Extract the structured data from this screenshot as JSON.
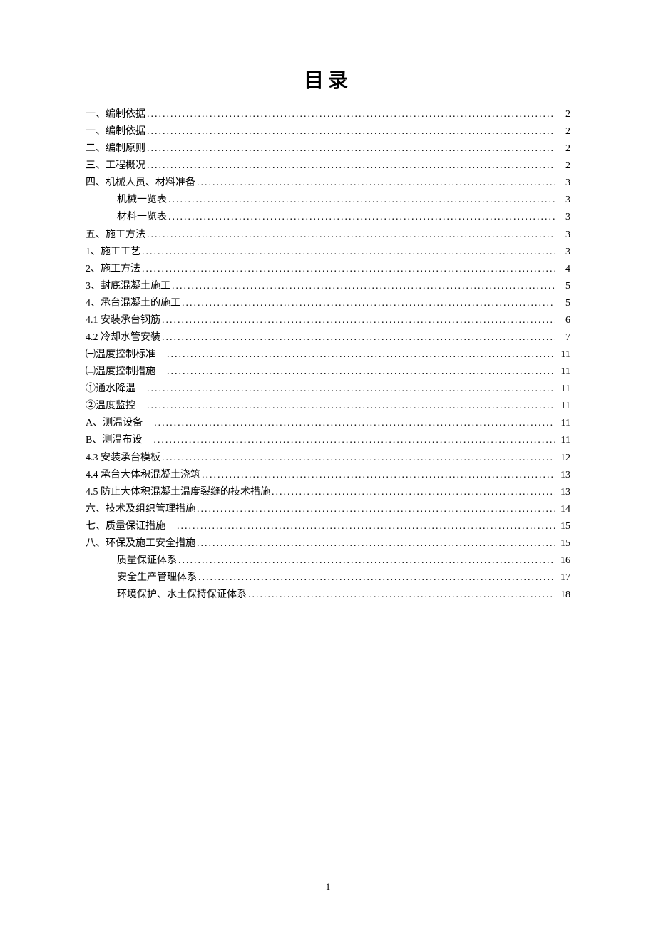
{
  "title": "目录",
  "page_number": "1",
  "toc": [
    {
      "label": "一、编制依据",
      "page": "2",
      "indent": false
    },
    {
      "label": "一、编制依据",
      "page": "2",
      "indent": false
    },
    {
      "label": "二、编制原则",
      "page": "2",
      "indent": false
    },
    {
      "label": "三、工程概况",
      "page": "2",
      "indent": false
    },
    {
      "label": "四、机械人员、材料准备",
      "page": "3",
      "indent": false
    },
    {
      "label": "机械一览表",
      "page": "3",
      "indent": true
    },
    {
      "label": "材料一览表",
      "page": "3",
      "indent": true
    },
    {
      "label": "五、施工方法",
      "page": "3",
      "indent": false
    },
    {
      "label": "1、施工工艺",
      "page": "3",
      "indent": false
    },
    {
      "label": "2、施工方法",
      "page": "4",
      "indent": false
    },
    {
      "label": "3、封底混凝土施工",
      "page": "5",
      "indent": false
    },
    {
      "label": "4、承台混凝土的施工",
      "page": "5",
      "indent": false
    },
    {
      "label": "4.1 安装承台钢筋",
      "page": "6",
      "indent": false
    },
    {
      "label": "4.2 冷却水管安装",
      "page": "7",
      "indent": false
    },
    {
      "label": "㈠温度控制标准　",
      "page": "11",
      "indent": false
    },
    {
      "label": "㈡温度控制措施　",
      "page": "11",
      "indent": false
    },
    {
      "label": "①通水降温　",
      "page": "11",
      "indent": false
    },
    {
      "label": "②温度监控　",
      "page": "11",
      "indent": false
    },
    {
      "label": "A、测温设备　",
      "page": "11",
      "indent": false
    },
    {
      "label": "B、测温布设　",
      "page": "11",
      "indent": false
    },
    {
      "label": "4.3 安装承台模板",
      "page": "12",
      "indent": false
    },
    {
      "label": "4.4 承台大体积混凝土浇筑",
      "page": "13",
      "indent": false
    },
    {
      "label": "4.5 防止大体积混凝土温度裂缝的技术措施",
      "page": "13",
      "indent": false
    },
    {
      "label": "六、技术及组织管理措施",
      "page": "14",
      "indent": false
    },
    {
      "label": "七、质量保证措施　",
      "page": "15",
      "indent": false
    },
    {
      "label": "八、环保及施工安全措施",
      "page": "15",
      "indent": false
    },
    {
      "label": "质量保证体系",
      "page": "16",
      "indent": true
    },
    {
      "label": "安全生产管理体系",
      "page": "17",
      "indent": true
    },
    {
      "label": "环境保护、水土保持保证体系",
      "page": "18",
      "indent": true
    }
  ]
}
